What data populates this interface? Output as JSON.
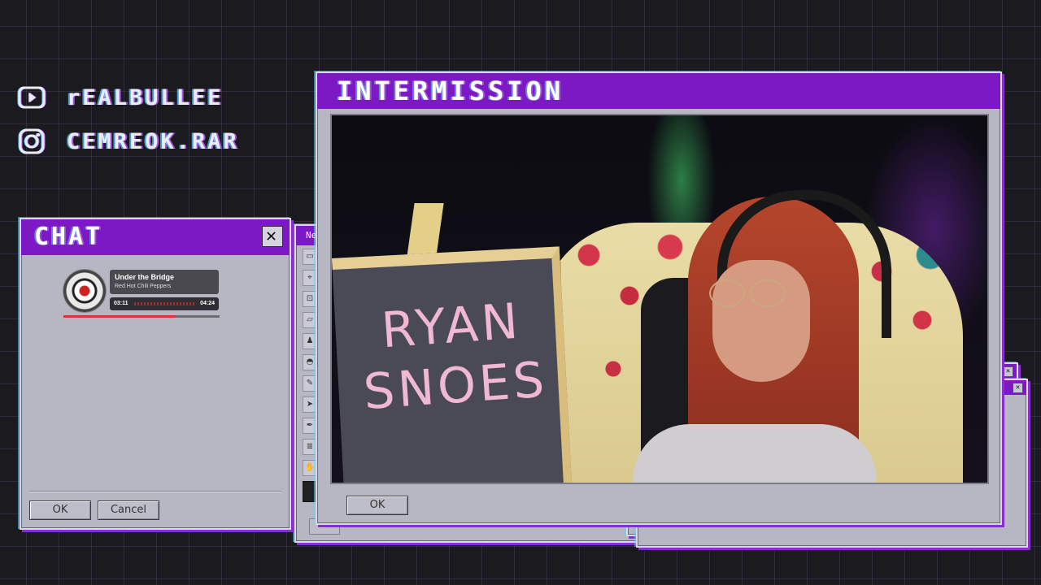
{
  "overlay": {
    "socials": [
      {
        "platform": "youtube",
        "icon": "youtube-icon",
        "handle": "rEALBULLEE"
      },
      {
        "platform": "instagram",
        "icon": "instagram-icon",
        "handle": "CEMREOK.RAR"
      }
    ]
  },
  "chat_window": {
    "title": "CHAT",
    "close_glyph": "✕",
    "ok_label": "OK",
    "cancel_label": "Cancel"
  },
  "now_playing": {
    "track": "Under the Bridge",
    "artist": "Red Hot Chili Peppers",
    "elapsed": "03:11",
    "duration": "04:24",
    "progress_fraction": 0.72
  },
  "back_window": {
    "title_fragment": "Ne"
  },
  "main_window": {
    "title": "INTERMISSION",
    "ok_label": "OK",
    "camera": {
      "board_text_line1": "RYAN",
      "board_text_line2": "SNOES"
    }
  },
  "colors": {
    "titlebar": "#7d18c5",
    "window_body": "#b7b6c3",
    "background": "#1b1b1f",
    "accent_shadow": "#8a2ed0",
    "progress": "#d8353a"
  }
}
